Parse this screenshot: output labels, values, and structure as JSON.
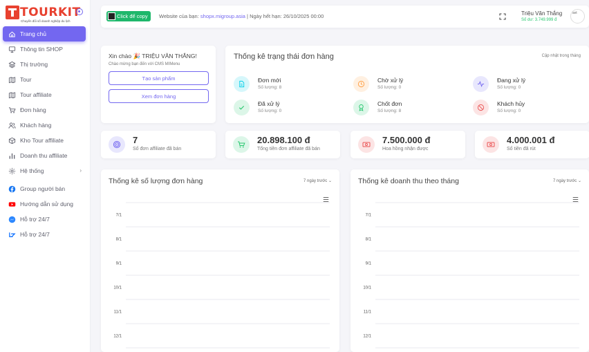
{
  "brand": {
    "name": "TOURKIT",
    "tagline": "Chuyển đổi số doanh nghiệp du lịch"
  },
  "sidebar": {
    "items": [
      {
        "label": "Trang chủ",
        "icon": "home-icon",
        "active": true
      },
      {
        "label": "Thông tin SHOP",
        "icon": "monitor-icon"
      },
      {
        "label": "Thị trường",
        "icon": "layers-icon"
      },
      {
        "label": "Tour",
        "icon": "map-icon"
      },
      {
        "label": "Tour affiliate",
        "icon": "map-icon"
      },
      {
        "label": "Đơn hàng",
        "icon": "cart-icon"
      },
      {
        "label": "Khách hàng",
        "icon": "users-icon"
      },
      {
        "label": "Kho Tour affiliate",
        "icon": "box-icon"
      },
      {
        "label": "Doanh thu affiliate",
        "icon": "bar-chart-icon"
      },
      {
        "label": "Hệ thống",
        "icon": "gear-icon",
        "has_children": true
      },
      {
        "label": "Group người bán",
        "icon": "facebook-icon"
      },
      {
        "label": "Hướng dẫn sử dụng",
        "icon": "youtube-icon"
      },
      {
        "label": "Hỗ trợ 24/7",
        "icon": "messenger-icon"
      },
      {
        "label": "Hỗ trợ 24/7",
        "icon": "zalo-icon"
      }
    ]
  },
  "topbar": {
    "copy_label": "Click để copy",
    "website_prefix": "Website của bạn: ",
    "website_url": "shopx.migroup.asia",
    "expiry": " | Ngày hết hạn: 26/10/2025 00:00",
    "user_name": "Triệu Văn Thắng",
    "balance": "Số dư: 3.749.999 đ",
    "avatar_alt": "avt"
  },
  "welcome": {
    "title": "Xin chào 🎉 TRIỆU VĂN THẮNG!",
    "subtitle": "Chào mừng bạn đến với CMS MIMenu",
    "create_product": "Tạo sản phẩm",
    "view_orders": "Xem đơn hàng"
  },
  "order_status": {
    "title": "Thống kê trạng thái đơn hàng",
    "updated": "Cập nhật trong tháng",
    "items": [
      {
        "label": "Đơn mới",
        "count": "Số lượng: 8",
        "icon": "document-icon",
        "color": "#00cfe8"
      },
      {
        "label": "Chờ xử lý",
        "count": "Số lượng: 0",
        "icon": "clock-icon",
        "color": "#ff9f43"
      },
      {
        "label": "Đang xử lý",
        "count": "Số lượng: 0",
        "icon": "activity-icon",
        "color": "#7367f0"
      },
      {
        "label": "Đã xử lý",
        "count": "Số lượng: 0",
        "icon": "check-icon",
        "color": "#28c76f"
      },
      {
        "label": "Chốt đơn",
        "count": "Số lượng: 8",
        "icon": "award-icon",
        "color": "#28c76f"
      },
      {
        "label": "Khách hủy",
        "count": "Số lượng: 0",
        "icon": "ban-icon",
        "color": "#ea5455"
      }
    ]
  },
  "summary": [
    {
      "value": "7",
      "label": "Số đơn affiliate đã bán",
      "icon": "target-icon",
      "color": "#7367f0"
    },
    {
      "value": "20.898.100 đ",
      "label": "Tổng tiền đơn affiliate đã bán",
      "icon": "cart-icon",
      "color": "#28c76f"
    },
    {
      "value": "7.500.000 đ",
      "label": "Hoa hồng nhận được",
      "icon": "money-icon",
      "color": "#ea5455"
    },
    {
      "value": "4.000.001 đ",
      "label": "Số tiền đã rút",
      "icon": "money-icon",
      "color": "#ea5455"
    }
  ],
  "charts": [
    {
      "title": "Thống kê số lượng đơn hàng",
      "range": "7 ngày trước"
    },
    {
      "title": "Thống kê doanh thu theo tháng",
      "range": "7 ngày trước"
    }
  ],
  "chart_data": [
    {
      "type": "bar",
      "title": "Thống kê số lượng đơn hàng",
      "categories": [
        "7/1",
        "8/1",
        "9/1",
        "10/1",
        "11/1",
        "12/1"
      ],
      "values": [],
      "orientation": "horizontal"
    },
    {
      "type": "bar",
      "title": "Thống kê doanh thu theo tháng",
      "categories": [
        "7/1",
        "8/1",
        "9/1",
        "10/1",
        "11/1",
        "12/1"
      ],
      "values": [],
      "orientation": "horizontal"
    }
  ]
}
